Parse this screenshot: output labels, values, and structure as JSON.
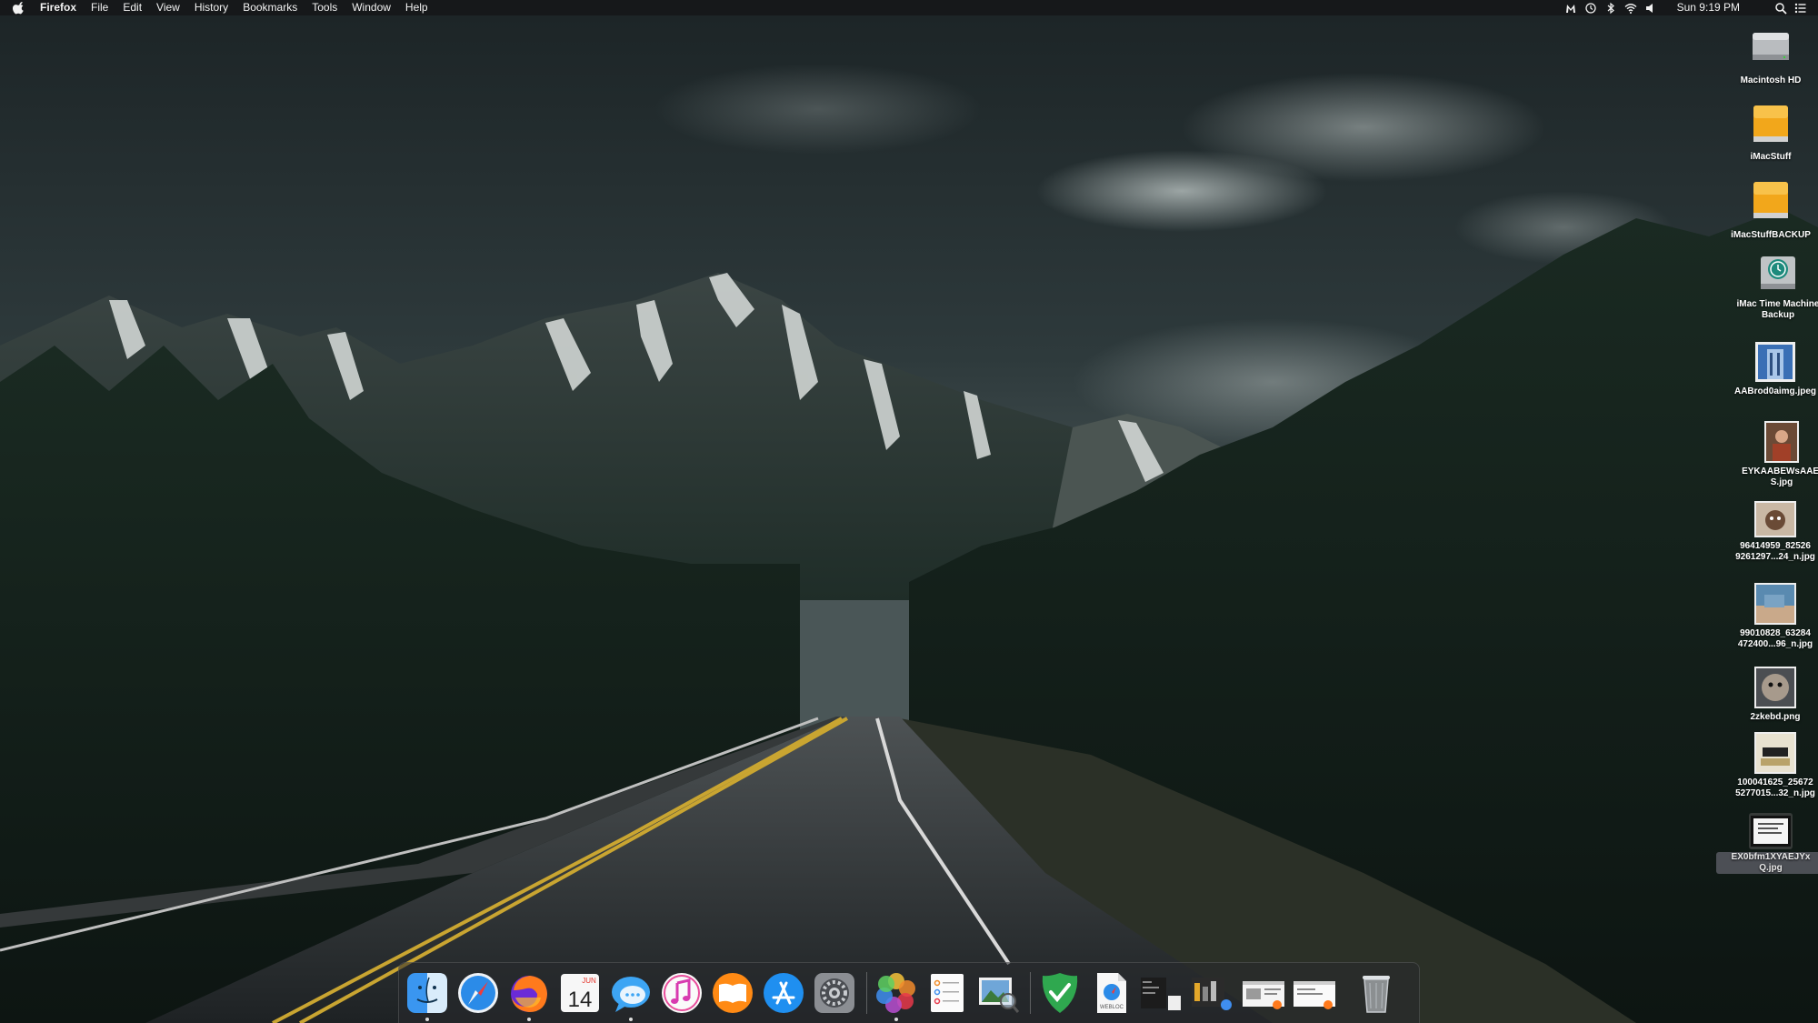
{
  "menubar": {
    "app_name": "Firefox",
    "menus": [
      "File",
      "Edit",
      "View",
      "History",
      "Bookmarks",
      "Tools",
      "Window",
      "Help"
    ],
    "clock": "Sun 9:19 PM",
    "status_icons": [
      "malwarebytes-icon",
      "time-machine-icon",
      "bluetooth-icon",
      "wifi-icon",
      "volume-icon"
    ],
    "right_icons": [
      "spotlight-icon",
      "notification-center-icon"
    ]
  },
  "desktop": {
    "icons": [
      {
        "label": "Macintosh HD",
        "type": "hard-drive"
      },
      {
        "label": "iMacStuff",
        "type": "external-drive"
      },
      {
        "label": "iMacStuffBACKUP",
        "type": "external-drive"
      },
      {
        "label": "iMac Time Machine Backup",
        "type": "time-machine-drive"
      },
      {
        "label": "AABrod0aimg.jpeg",
        "type": "image"
      },
      {
        "label": "EYKAABEWsAAEl S.jpg",
        "type": "image"
      },
      {
        "label": "96414959_82526 9261297...24_n.jpg",
        "type": "image"
      },
      {
        "label": "99010828_63284 472400...96_n.jpg",
        "type": "image"
      },
      {
        "label": "2zkebd.png",
        "type": "image"
      },
      {
        "label": "100041625_25672 5277015...32_n.jpg",
        "type": "image"
      },
      {
        "label": "EX0bfm1XYAEJYx Q.jpg",
        "type": "image",
        "selected": true
      }
    ]
  },
  "dock": {
    "calendar_month": "JUN",
    "calendar_day": "14",
    "apps": [
      "Finder",
      "Safari",
      "Firefox",
      "Calendar",
      "Messages",
      "iTunes",
      "Books",
      "App Store",
      "System Preferences",
      "Photos",
      "Reminders",
      "Preview",
      "AdGuard",
      "Webloc",
      "Minimized Window 1",
      "Minimized Window 2",
      "Minimized Window 3",
      "Minimized Window 4",
      "Trash"
    ],
    "webloc_label": "WEBLOC"
  }
}
